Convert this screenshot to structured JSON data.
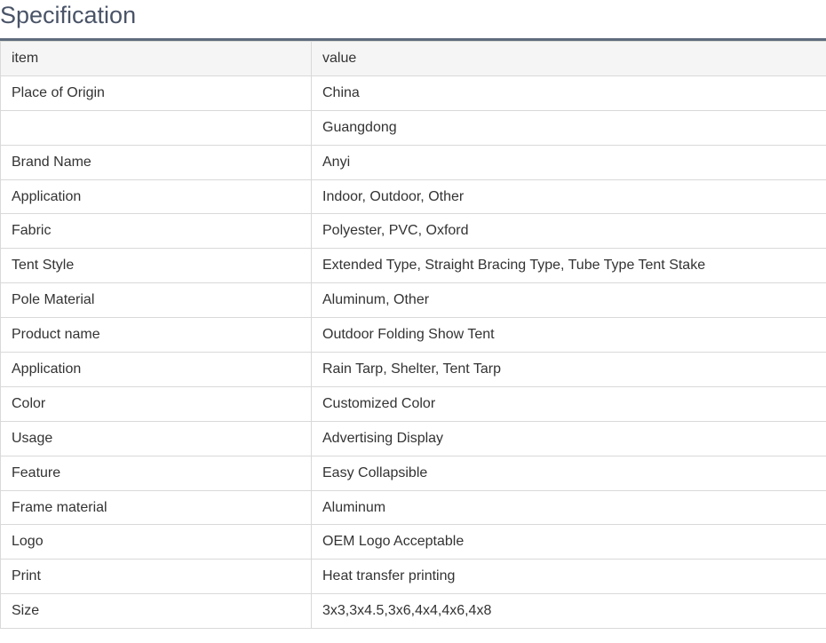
{
  "section": {
    "title": "Specification"
  },
  "table": {
    "header": {
      "item": "item",
      "value": "value"
    },
    "rows": [
      {
        "item": "Place of Origin",
        "value": "China"
      },
      {
        "item": "",
        "value": "Guangdong"
      },
      {
        "item": "Brand Name",
        "value": "Anyi"
      },
      {
        "item": "Application",
        "value": "Indoor, Outdoor, Other"
      },
      {
        "item": "Fabric",
        "value": "Polyester, PVC, Oxford"
      },
      {
        "item": "Tent Style",
        "value": "Extended Type, Straight Bracing Type, Tube Type Tent Stake"
      },
      {
        "item": "Pole Material",
        "value": "Aluminum, Other"
      },
      {
        "item": "Product name",
        "value": "Outdoor Folding Show Tent"
      },
      {
        "item": "Application",
        "value": "Rain Tarp, Shelter, Tent Tarp"
      },
      {
        "item": "Color",
        "value": "Customized Color"
      },
      {
        "item": "Usage",
        "value": "Advertising Display"
      },
      {
        "item": "Feature",
        "value": "Easy Collapsible"
      },
      {
        "item": "Frame material",
        "value": "Aluminum"
      },
      {
        "item": "Logo",
        "value": "OEM Logo Acceptable"
      },
      {
        "item": "Print",
        "value": "Heat transfer printing"
      },
      {
        "item": "Size",
        "value": "3x3,3x4.5,3x6,4x4,4x6,4x8"
      }
    ]
  }
}
